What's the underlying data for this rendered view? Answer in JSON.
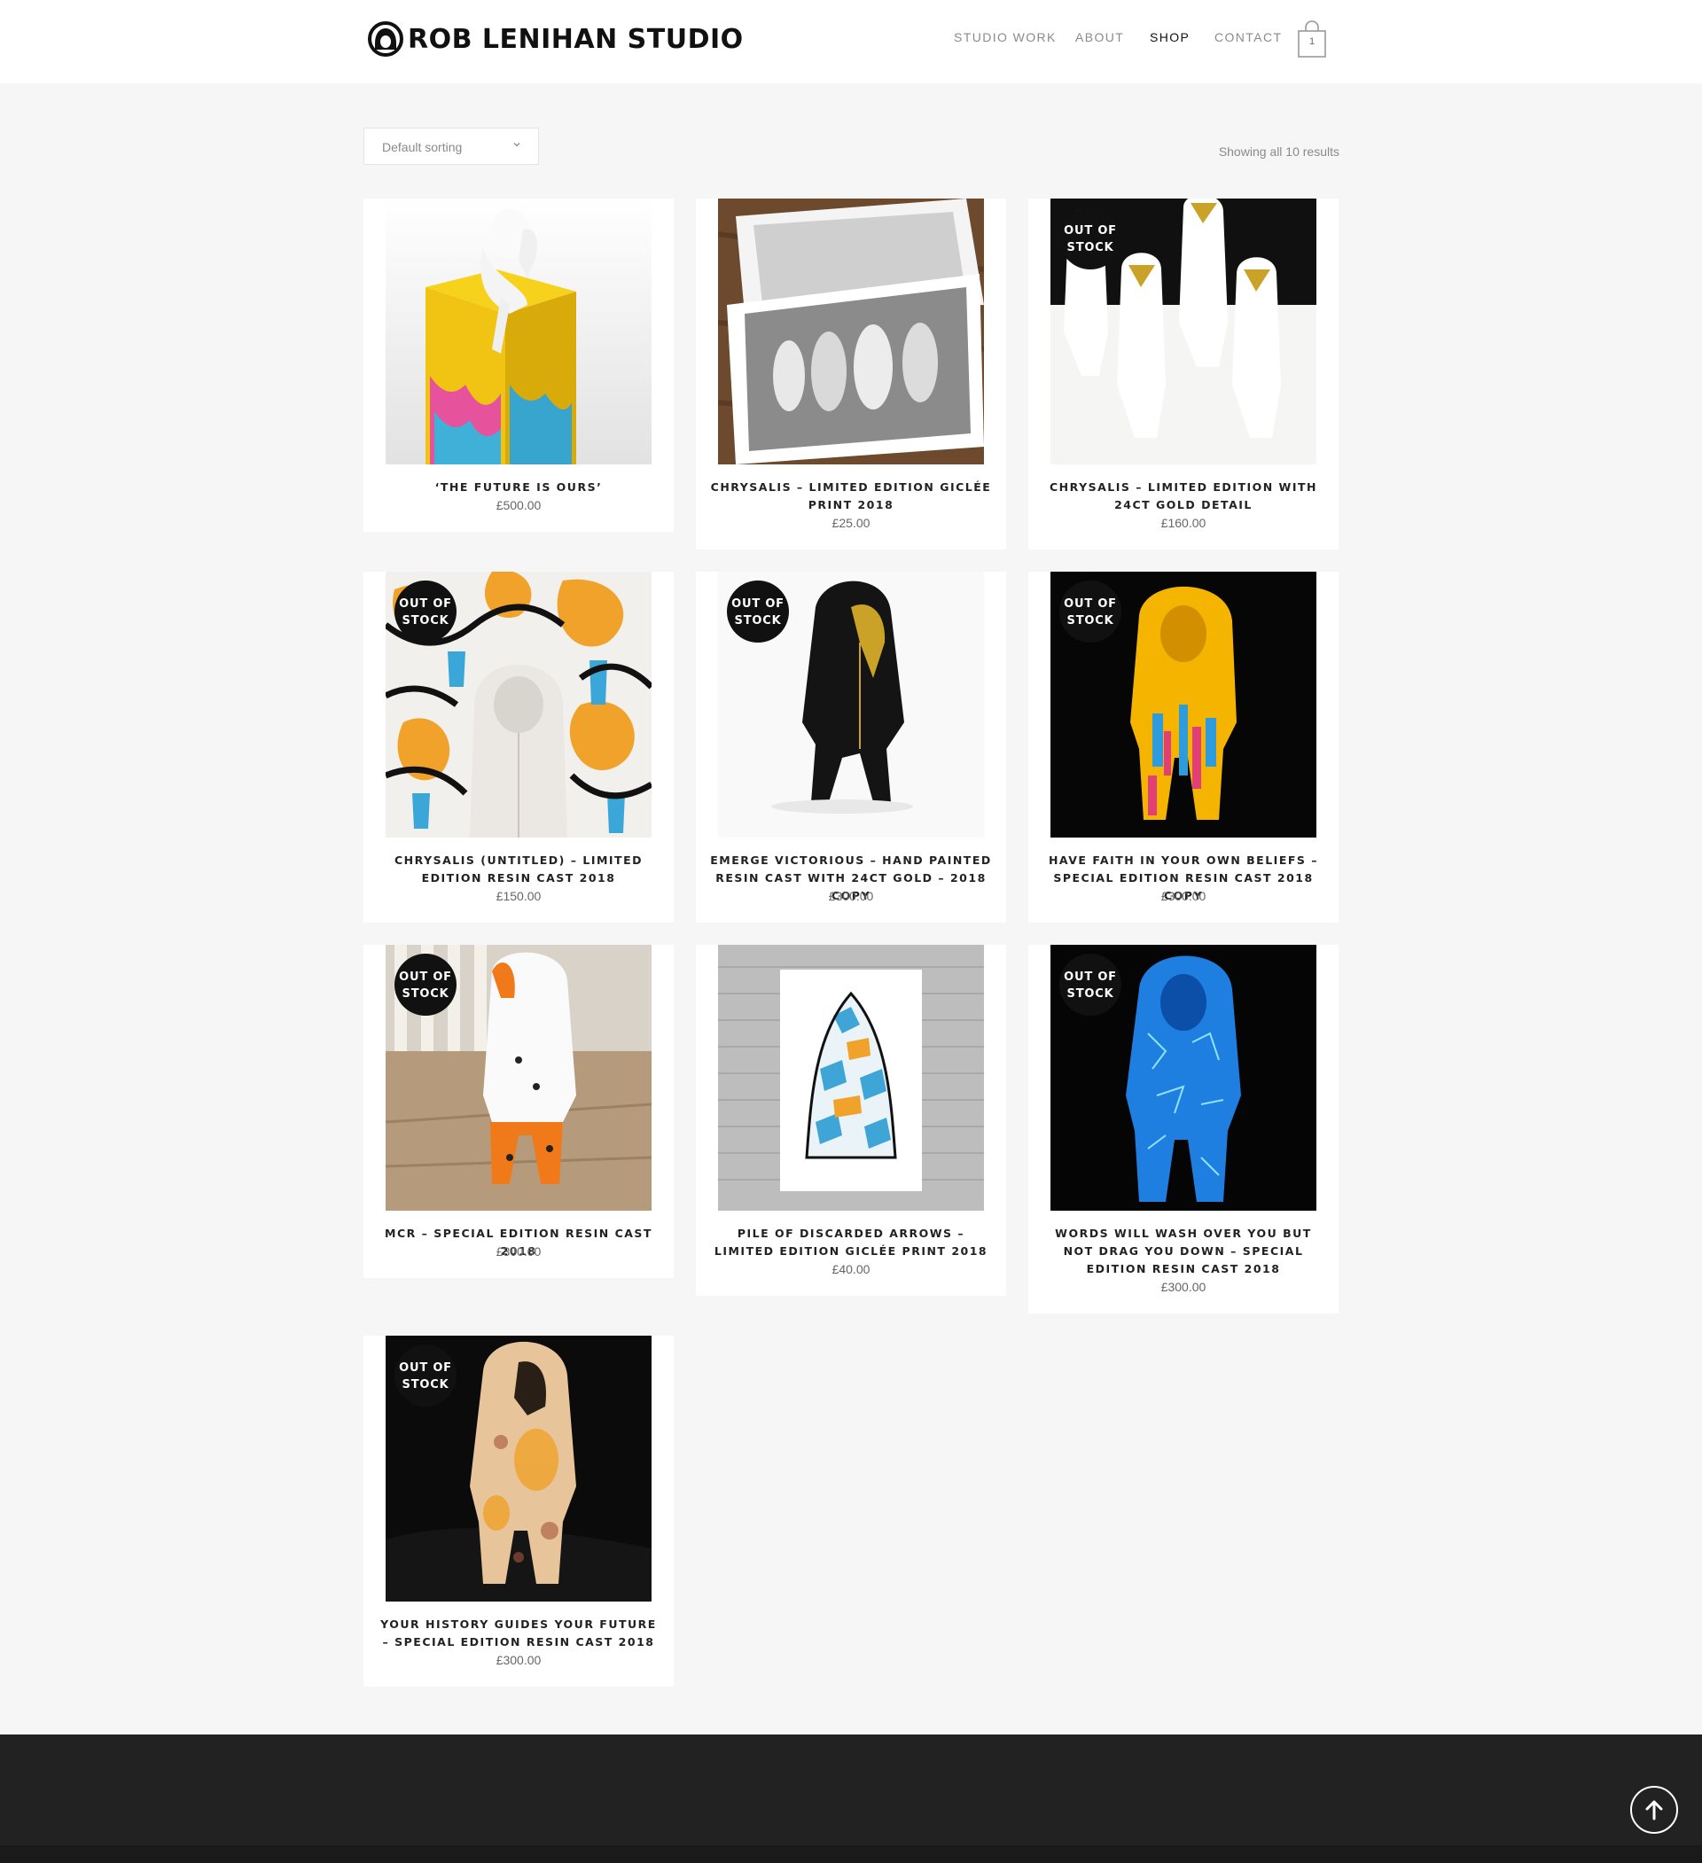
{
  "header": {
    "logo_text": "ROB LENIHAN STUDIO",
    "nav": [
      "STUDIO WORK",
      "ABOUT",
      "SHOP",
      "CONTACT"
    ],
    "active_nav": "SHOP",
    "cart_count": "1"
  },
  "toolbar": {
    "sort_label": "Default sorting",
    "result_count": "Showing all 10 results"
  },
  "badge_text_line1": "OUT OF",
  "badge_text_line2": "STOCK",
  "products": [
    {
      "title": "‘The Future is Ours’",
      "price": "£500.00",
      "out_of_stock": false
    },
    {
      "title": "Chrysalis – Limited Edition Giclée Print 2018",
      "price": "£25.00",
      "out_of_stock": false
    },
    {
      "title": "Chrysalis – Limited Edition with 24ct Gold Detail",
      "price": "£160.00",
      "out_of_stock": true
    },
    {
      "title": "Chrysalis (Untitled) – Limited Edition Resin Cast 2018",
      "price": "£150.00",
      "out_of_stock": true
    },
    {
      "title": "Emerge Victorious – Hand Painted Resin Cast with 24ct Gold – 2018 Copy",
      "price": "£300.00",
      "out_of_stock": true
    },
    {
      "title": "Have Faith in Your Own Beliefs – Special Edition Resin Cast 2018 Copy",
      "price": "£300.00",
      "out_of_stock": true
    },
    {
      "title": "MCR – Special Edition Resin Cast 2018",
      "price": "£300.00",
      "out_of_stock": true
    },
    {
      "title": "Pile of Discarded Arrows – Limited Edition Giclée Print 2018",
      "price": "£40.00",
      "out_of_stock": false
    },
    {
      "title": "Words Will Wash Over You But Not Drag You Down – Special Edition Resin Cast 2018",
      "price": "£300.00",
      "out_of_stock": true
    },
    {
      "title": "Your History Guides Your Future – Special Edition Resin Cast 2018",
      "price": "£300.00",
      "out_of_stock": true
    }
  ],
  "colors": {
    "page_bg": "#f6f6f6",
    "header_bg": "#ffffff",
    "footer_bg": "#222222",
    "badge_bg": "#111111"
  }
}
